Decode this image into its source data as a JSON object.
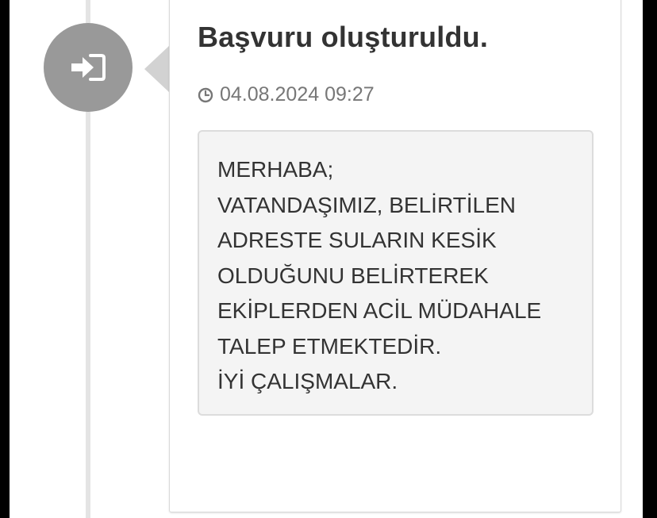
{
  "event": {
    "icon": "sign-in-icon",
    "title": "Başvuru oluşturuldu.",
    "time_icon": "clock-icon",
    "timestamp": "04.08.2024 09:27",
    "message_lines": [
      "MERHABA;",
      "VATANDAŞIMIZ, BELİRTİLEN",
      "ADRESTE SULARIN KESİK",
      "OLDUĞUNU BELİRTEREK",
      "EKİPLERDEN ACİL MÜDAHALE",
      "TALEP ETMEKTEDİR.",
      "İYİ ÇALIŞMALAR."
    ]
  },
  "colors": {
    "icon_circle": "#999999",
    "timeline_line": "#e4e4e4",
    "title_text": "#333333",
    "time_text": "#777777",
    "message_bg": "#f4f4f4"
  }
}
